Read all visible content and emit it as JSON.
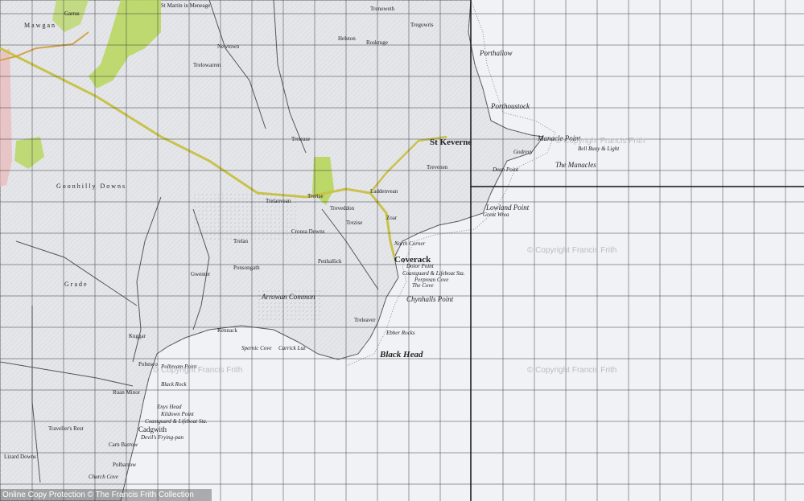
{
  "colors": {
    "land": "#e4e6ea",
    "sea": "#f1f2f5",
    "grid": "#3a3a3a",
    "woodland": "#b6d65a",
    "road_main": "#c9c24a",
    "coast": "#555"
  },
  "places": {
    "top": [
      "Garras",
      "Mawgan",
      "St Martin in Meneage",
      "Newtown",
      "Trelowarren",
      "Helston",
      "Trenoweth",
      "Roskruge",
      "Tregowris",
      "Porthallow",
      "Porthoustock",
      "Manacle Point",
      "Bell Buoy & Light",
      "The Manacles",
      "Lowland Point",
      "Great Wrea",
      "Godrevy",
      "Dean Point",
      "St Keverne",
      "Trelease",
      "Laddenvean",
      "Trevenen"
    ],
    "middle": [
      "Trelan",
      "Gwenter",
      "Penhallick",
      "Crousa Downs",
      "Goonhilly Downs",
      "Arrowan Common",
      "Treveddon",
      "Trerise",
      "Zoar",
      "Trelanvean",
      "Trezise",
      "Coverack",
      "Dolor Point",
      "North Corner",
      "Coastguard & Lifeboat Sta.",
      "Perprean Cove",
      "The Cove",
      "Chynhalls Point",
      "Treleaver",
      "Black Head",
      "Ebber Rocks",
      "Carrick Luz",
      "Spernic Cove",
      "Polbream Point",
      "Kennack",
      "Ponsongath"
    ],
    "bottom": [
      "Poltesco",
      "Enys Head",
      "Black Rock",
      "Kildown Point",
      "Coastguard & Lifeboat Sta.",
      "Cadgwith",
      "Devil's Frying-pan",
      "Carn Barrow",
      "Polbarrow",
      "Lizard Downs",
      "Traveller's Rest",
      "Ruan Minor",
      "Grade",
      "Kuggar",
      "Church Cove"
    ]
  },
  "watermarks": [
    "© Copyright Francis Frith",
    "© Copyright Francis Frith",
    "© Copyright Francis Frith",
    "© Copyright Francis Frith"
  ],
  "footer": "Online Copy Protection © The Francis Frith Collection"
}
